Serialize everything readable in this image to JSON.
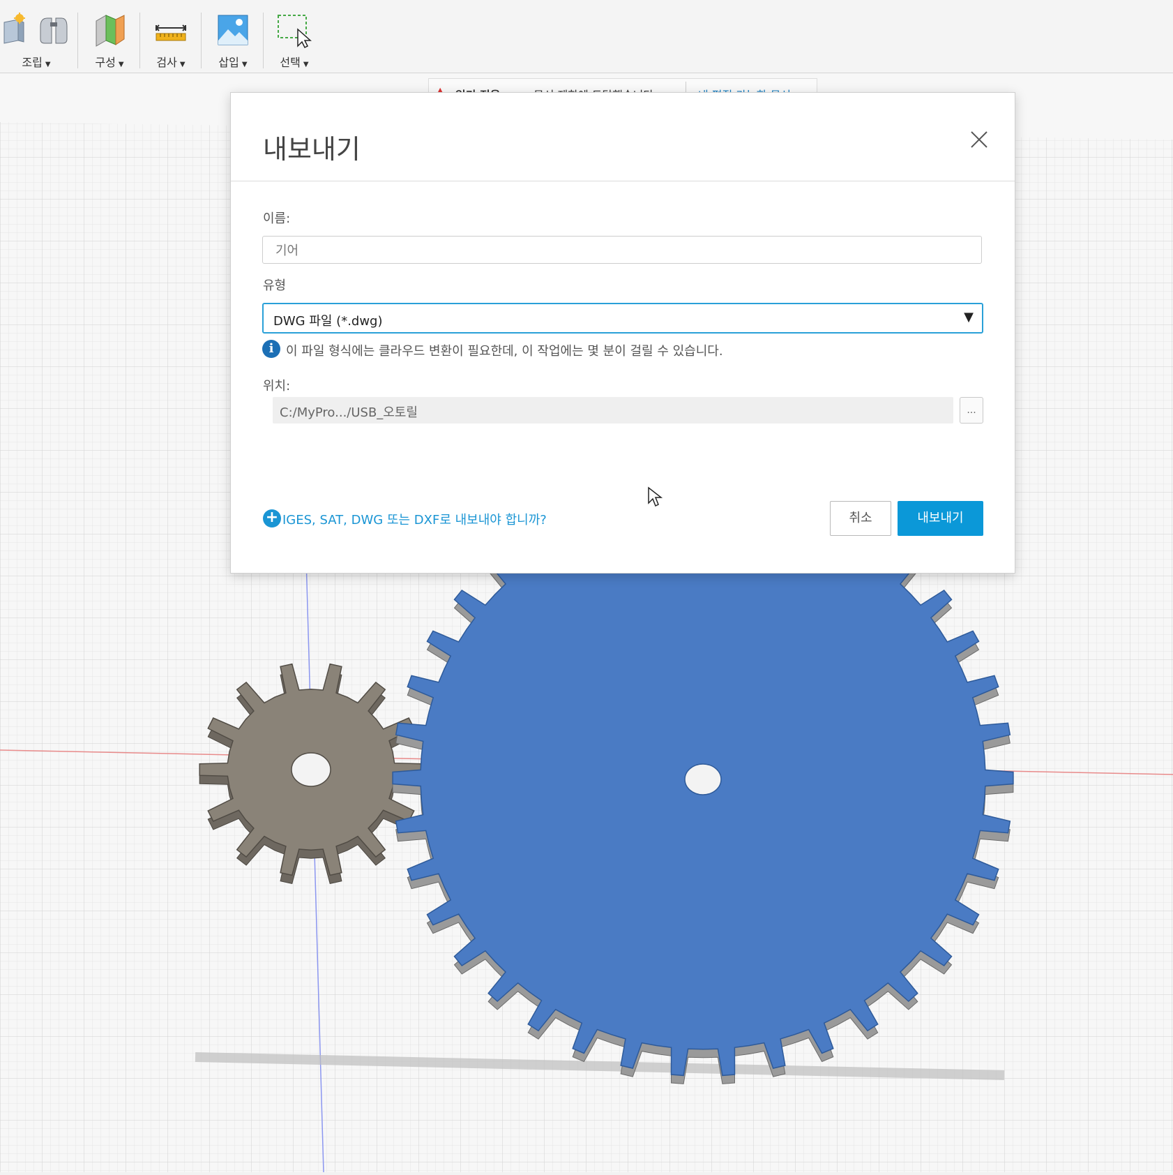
{
  "toolbar": {
    "groups": [
      {
        "label": "조립",
        "icons": [
          "assemble-new-component-icon",
          "joint-icon"
        ]
      },
      {
        "label": "구성",
        "icons": [
          "construct-plane-icon"
        ]
      },
      {
        "label": "검사",
        "icons": [
          "measure-ruler-icon"
        ]
      },
      {
        "label": "삽입",
        "icons": [
          "insert-image-icon"
        ]
      },
      {
        "label": "선택",
        "icons": [
          "select-window-icon"
        ]
      }
    ]
  },
  "banner": {
    "title": "읽기 전용:",
    "message": "문서 제한에 도달했습니다",
    "link": "내 편집 가능한 문서"
  },
  "dialog": {
    "title": "내보내기",
    "name_label": "이름:",
    "name_value": "기어",
    "type_label": "유형",
    "type_value": "DWG 파일 (*.dwg)",
    "info_text": "이 파일 형식에는 클라우드 변환이 필요한데, 이 작업에는 몇 분이 걸릴 수 있습니다.",
    "location_label": "위치:",
    "location_value": "C:/MyPro.../USB_오토릴",
    "browse_label": "...",
    "help_link": "IGES, SAT, DWG 또는 DXF로 내보내야 합니까?",
    "cancel_label": "취소",
    "export_label": "내보내기"
  },
  "colors": {
    "accent": "#0b98d8",
    "select_border": "#2aa0d8",
    "info_icon": "#1c6fb5",
    "large_gear": "#4a7bc4",
    "small_gear": "#8a8378",
    "grid_line": "#dcdcdc",
    "x_axis": "#e06060",
    "y_axis": "#6f7ef0"
  }
}
